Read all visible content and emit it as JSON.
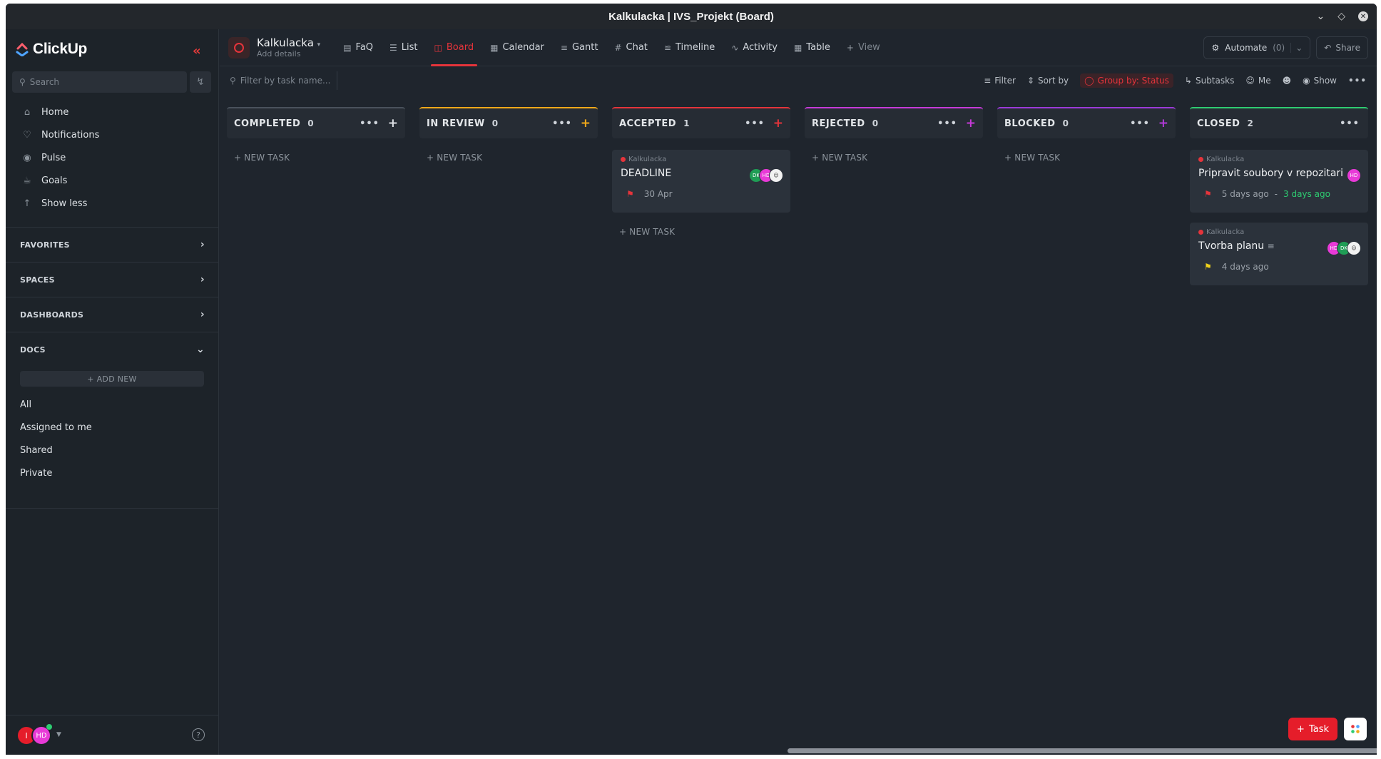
{
  "window": {
    "title": "Kalkulacka | IVS_Projekt (Board)"
  },
  "sidebar": {
    "logo_text": "ClickUp",
    "search_placeholder": "Search",
    "nav": [
      {
        "label": "Home",
        "icon": "home-icon"
      },
      {
        "label": "Notifications",
        "icon": "bell-icon"
      },
      {
        "label": "Pulse",
        "icon": "pulse-icon"
      },
      {
        "label": "Goals",
        "icon": "trophy-icon"
      },
      {
        "label": "Show less",
        "icon": "arrow-up-icon"
      }
    ],
    "sections": {
      "favorites": "FAVORITES",
      "spaces": "SPACES",
      "dashboards": "DASHBOARDS",
      "docs": "DOCS"
    },
    "add_new": "+ ADD NEW",
    "docs_items": [
      "All",
      "Assigned to me",
      "Shared",
      "Private"
    ],
    "user_initials": [
      "I",
      "HD"
    ]
  },
  "header": {
    "project_name": "Kalkulacka",
    "project_sub": "Add details",
    "views": [
      {
        "label": "FaQ",
        "icon": "doc-icon",
        "active": false
      },
      {
        "label": "List",
        "icon": "list-icon",
        "active": false
      },
      {
        "label": "Board",
        "icon": "board-icon",
        "active": true
      },
      {
        "label": "Calendar",
        "icon": "calendar-icon",
        "active": false
      },
      {
        "label": "Gantt",
        "icon": "gantt-icon",
        "active": false
      },
      {
        "label": "Chat",
        "icon": "hash-icon",
        "active": false
      },
      {
        "label": "Timeline",
        "icon": "timeline-icon",
        "active": false
      },
      {
        "label": "Activity",
        "icon": "activity-icon",
        "active": false
      },
      {
        "label": "Table",
        "icon": "table-icon",
        "active": false
      },
      {
        "label": "View",
        "icon": "plus-icon",
        "active": false
      }
    ],
    "automate_label": "Automate",
    "automate_count": "(0)",
    "share_label": "Share"
  },
  "toolbar": {
    "filter_placeholder": "Filter by task name...",
    "filter": "Filter",
    "sort": "Sort by",
    "group": "Group by: Status",
    "subtasks": "Subtasks",
    "me": "Me",
    "show": "Show"
  },
  "columns": [
    {
      "title": "COMPLETED",
      "count": "0",
      "color": "#4a525c",
      "plus_color": "#dde1e5",
      "new_task": "+ NEW TASK",
      "cards": []
    },
    {
      "title": "IN REVIEW",
      "count": "0",
      "color": "#f0a81a",
      "plus_color": "#f0a81a",
      "new_task": "+ NEW TASK",
      "cards": []
    },
    {
      "title": "ACCEPTED",
      "count": "1",
      "color": "#e5343b",
      "plus_color": "#e5343b",
      "new_task": "+ NEW TASK",
      "cards": [
        {
          "list": "Kalkulacka",
          "title": "DEADLINE",
          "flag_color": "#e5343b",
          "meta": "30 Apr",
          "meta2": "",
          "assignees": [
            "DK",
            "HD",
            ""
          ]
        }
      ]
    },
    {
      "title": "REJECTED",
      "count": "0",
      "color": "#c63ad8",
      "plus_color": "#c63ad8",
      "new_task": "+ NEW TASK",
      "cards": []
    },
    {
      "title": "BLOCKED",
      "count": "0",
      "color": "#9b3ad8",
      "plus_color": "#b23ad8",
      "new_task": "+ NEW TASK",
      "cards": []
    },
    {
      "title": "CLOSED",
      "count": "2",
      "color": "#2ecc71",
      "plus_color": "",
      "new_task": "",
      "cards": [
        {
          "list": "Kalkulacka",
          "title": "Pripravit soubory v repozitari",
          "flag_color": "#e5343b",
          "meta": "5 days ago",
          "meta2": "3 days ago",
          "assignees": [
            "HD"
          ]
        },
        {
          "list": "Kalkulacka",
          "title": "Tvorba planu",
          "flag_color": "#f0d21a",
          "meta": "4 days ago",
          "meta2": "",
          "assignees": [
            "HD",
            "DK",
            ""
          ]
        }
      ]
    }
  ],
  "fab": {
    "task_label": "Task"
  }
}
